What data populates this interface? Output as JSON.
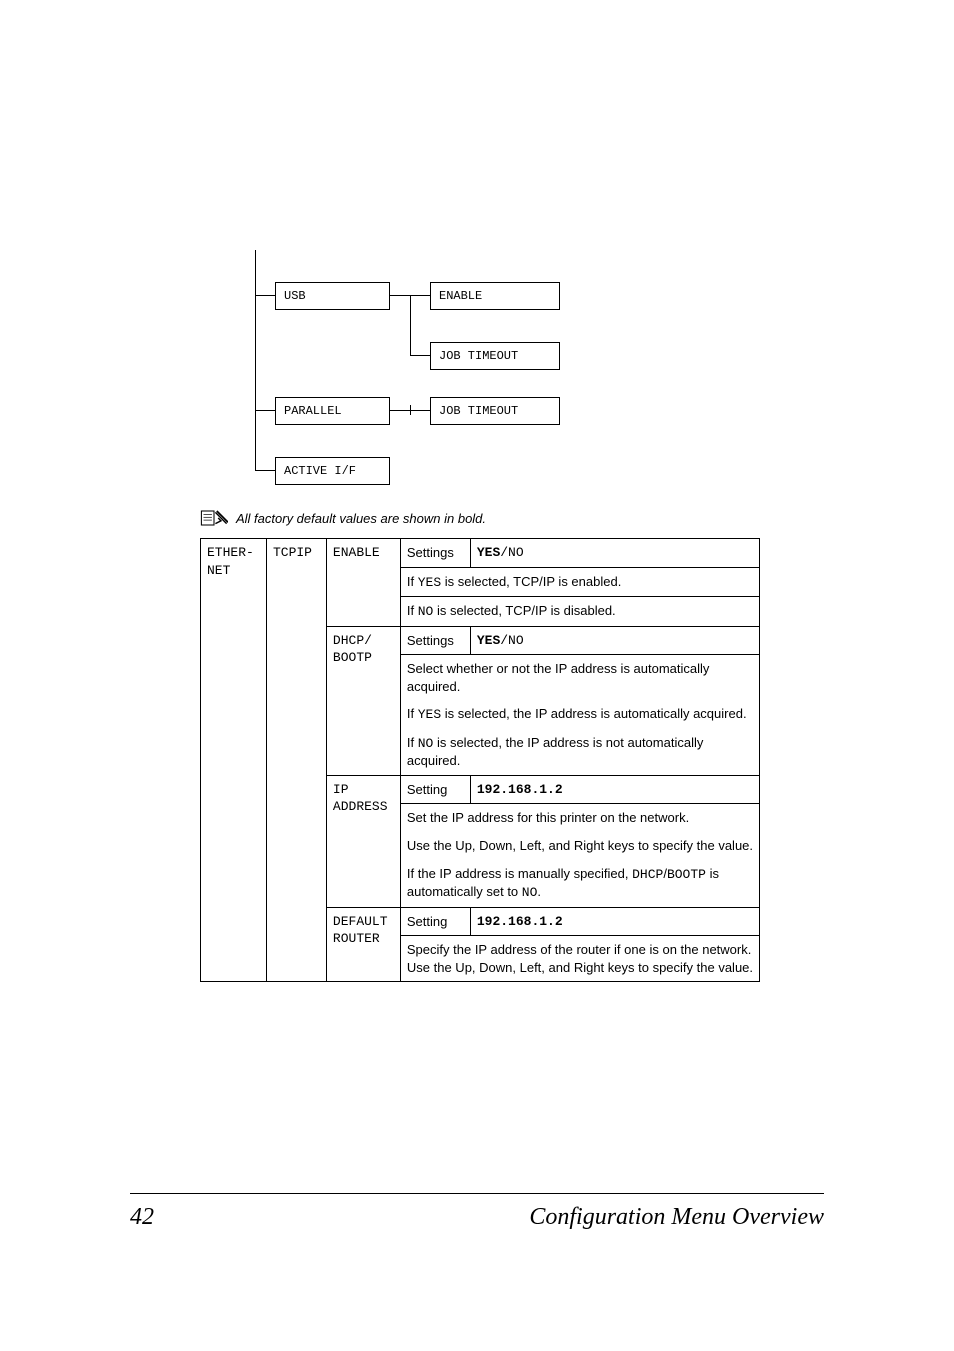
{
  "tree": {
    "usb": "USB",
    "enable": "ENABLE",
    "job_timeout_1": "JOB TIMEOUT",
    "parallel": "PARALLEL",
    "job_timeout_2": "JOB TIMEOUT",
    "active_if": "ACTIVE I/F"
  },
  "note": "All factory default values are shown in bold.",
  "table": {
    "row1_a": "ETHER-NET",
    "row1_b": "TCPIP",
    "enable_label": "ENABLE",
    "settings_label": "Settings",
    "setting_label": "Setting",
    "yes": "YES",
    "slash_no": "/NO",
    "enable_desc_1a": "If ",
    "enable_desc_1b": "YES",
    "enable_desc_1c": " is selected, TCP/IP is enabled.",
    "enable_desc_2a": "If ",
    "enable_desc_2b": "NO",
    "enable_desc_2c": " is selected, TCP/IP is disabled.",
    "dhcp_label_1": "DHCP/",
    "dhcp_label_2": "BOOTP",
    "dhcp_desc_1": "Select whether or not the IP address is automatically acquired.",
    "dhcp_desc_2a": "If ",
    "dhcp_desc_2b": "YES",
    "dhcp_desc_2c": " is selected, the IP address is automatically acquired.",
    "dhcp_desc_3a": "If ",
    "dhcp_desc_3b": "NO",
    "dhcp_desc_3c": " is selected, the IP address is not automatically acquired.",
    "ip_label_1": "IP",
    "ip_label_2": "ADDRESS",
    "ip_value": "192.168.1.2",
    "ip_desc_1": "Set the IP address for this printer on the network.",
    "ip_desc_2": "Use the Up, Down, Left, and Right keys to specify the value.",
    "ip_desc_3a": "If the IP address is manually specified, ",
    "ip_desc_3b": "DHCP",
    "ip_desc_3c": "/",
    "ip_desc_3d": "BOOTP",
    "ip_desc_3e": " is automatically set to ",
    "ip_desc_3f": "NO",
    "ip_desc_3g": ".",
    "router_label_1": "DEFAULT",
    "router_label_2": "ROUTER",
    "router_value": "192.168.1.2",
    "router_desc": "Specify the IP address of the router if one is on the network. Use the Up, Down, Left, and Right keys to specify the value."
  },
  "footer": {
    "page": "42",
    "title": "Configuration Menu Overview"
  }
}
